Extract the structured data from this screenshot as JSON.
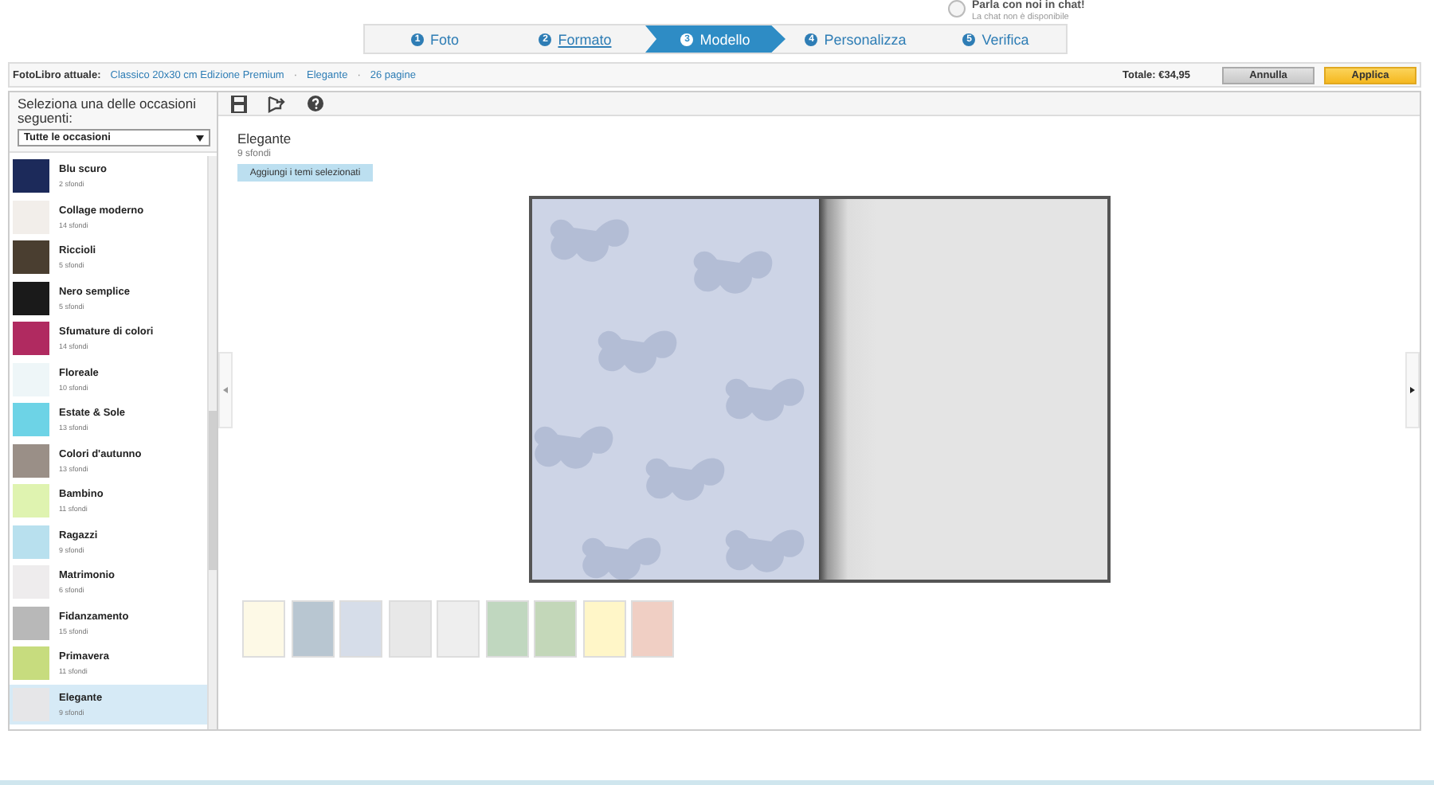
{
  "chat": {
    "title": "Parla con noi in chat!",
    "status": "La chat non è disponibile"
  },
  "steps": [
    {
      "number": "1",
      "label": "Foto",
      "selected": false,
      "link": false
    },
    {
      "number": "2",
      "label": "Formato",
      "selected": false,
      "link": true
    },
    {
      "number": "3",
      "label": "Modello",
      "selected": true,
      "link": false
    },
    {
      "number": "4",
      "label": "Personalizza",
      "selected": false,
      "link": false
    },
    {
      "number": "5",
      "label": "Verifica",
      "selected": false,
      "link": false
    }
  ],
  "summary": {
    "label": "FotoLibro attuale:",
    "items": [
      "Classico 20x30 cm Edizione Premium",
      "Elegante",
      "26 pagine"
    ],
    "separator": "·",
    "total": "Totale: €34,95"
  },
  "buttons": [
    {
      "label": "Annulla",
      "kind": "secondary"
    },
    {
      "label": "Applica",
      "kind": "primary"
    }
  ],
  "sidebar": {
    "heading": "Seleziona una delle occasioni seguenti:",
    "filter": "Tutte le occasioni",
    "items": [
      {
        "name": "Blu scuro",
        "count": "2 sfondi",
        "color": "#1c2a5a",
        "selected": false
      },
      {
        "name": "Collage moderno",
        "count": "14 sfondi",
        "color": "#f2eeea",
        "selected": false
      },
      {
        "name": "Riccioli",
        "count": "5 sfondi",
        "color": "#4a3e30",
        "selected": false
      },
      {
        "name": "Nero semplice",
        "count": "5 sfondi",
        "color": "#1a1a1a",
        "selected": false
      },
      {
        "name": "Sfumature di colori",
        "count": "14 sfondi",
        "color": "#b02a60",
        "selected": false
      },
      {
        "name": "Floreale",
        "count": "10 sfondi",
        "color": "#eef6f8",
        "selected": false
      },
      {
        "name": "Estate & Sole",
        "count": "13 sfondi",
        "color": "#6dd3e6",
        "selected": false
      },
      {
        "name": "Colori d'autunno",
        "count": "13 sfondi",
        "color": "#9a8f87",
        "selected": false
      },
      {
        "name": "Bambino",
        "count": "11 sfondi",
        "color": "#dff3b0",
        "selected": false
      },
      {
        "name": "Ragazzi",
        "count": "9 sfondi",
        "color": "#b8e0ee",
        "selected": false
      },
      {
        "name": "Matrimonio",
        "count": "6 sfondi",
        "color": "#eeeced",
        "selected": false
      },
      {
        "name": "Fidanzamento",
        "count": "15 sfondi",
        "color": "#b8b8b8",
        "selected": false
      },
      {
        "name": "Primavera",
        "count": "11 sfondi",
        "color": "#c7dc7e",
        "selected": false
      },
      {
        "name": "Elegante",
        "count": "9 sfondi",
        "color": "#e6e6e8",
        "selected": true
      }
    ]
  },
  "theme": {
    "title": "Elegante",
    "count": "9 sfondi",
    "add_button": "Aggiungi i temi selezionati"
  },
  "swatches": [
    {
      "color": "#fdf9e6"
    },
    {
      "color": "#b8c6d1"
    },
    {
      "color": "#d6dde9"
    },
    {
      "color": "#e8e8e8"
    },
    {
      "color": "#eeeeee"
    },
    {
      "color": "#c0d7bf"
    },
    {
      "color": "#c3d7b9"
    },
    {
      "color": "#fff6c8"
    },
    {
      "color": "#f0cfc4"
    }
  ]
}
